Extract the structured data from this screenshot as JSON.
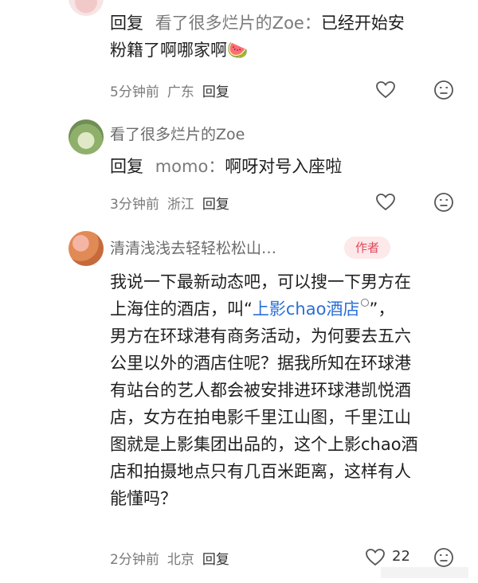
{
  "comments": [
    {
      "reply_prefix": "回复",
      "reply_target": "看了很多烂片的Zoe：",
      "text_line1": "已经开始安",
      "text_line2": "粉籍了啊哪家啊",
      "emoji": "🍉",
      "time": "5分钟前",
      "location": "广东",
      "reply_label": "回复"
    },
    {
      "author": "看了很多烂片的Zoe",
      "reply_prefix": "回复",
      "reply_target": "momo：",
      "text": "啊呀对号入座啦",
      "time": "3分钟前",
      "location": "浙江",
      "reply_label": "回复"
    },
    {
      "author": "清清浅浅去轻轻松松山…",
      "badge": "作者",
      "lines": [
        "我说一下最新动态吧，可以搜一下男方在",
        "上海住的酒店，叫“",
        "男方在环球港有商务活动，为何要去五六",
        "公里以外的酒店住呢？据我所知在环球港",
        "有站台的艺人都会被安排进环球港凯悦酒",
        "店，女方在拍电影千里江山图，千里江山",
        "图就是上影集团出品的，这个上影chao酒",
        "店和拍摄地点只有几百米距离，这样有人",
        "能懂吗？"
      ],
      "link_text": "上影chao酒店",
      "line2_suffix": "”，",
      "time": "2分钟前",
      "location": "北京",
      "reply_label": "回复",
      "like_count": "22"
    }
  ],
  "icons": {
    "like": "heart-icon",
    "dislike": "frown-face-icon",
    "search": "search-icon"
  },
  "colors": {
    "link": "#2b6fd6",
    "badge_bg": "#fde8ea",
    "badge_text": "#e2485c",
    "meta": "#7a7a7a"
  }
}
